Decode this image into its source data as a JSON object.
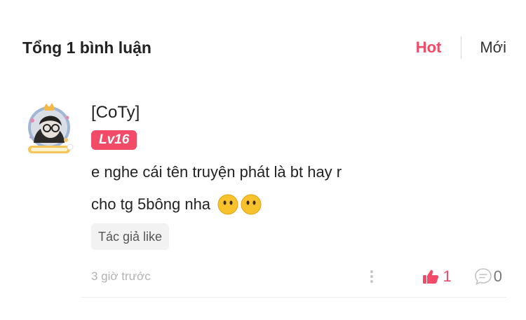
{
  "header": {
    "title": "Tổng 1 bình luận",
    "sort_tabs": [
      {
        "label": "Hot",
        "active": true
      },
      {
        "label": "Mới",
        "active": false
      }
    ]
  },
  "comment": {
    "username": "[CoTy]",
    "level": "Lv16",
    "text_line1": "e nghe cái tên truyện phát là bt hay r",
    "text_line2": "cho tg 5bông nha",
    "emojis": [
      "neutral-face-emoji",
      "neutral-face-emoji"
    ],
    "tag": "Tác giả like",
    "timestamp": "3 giờ trước",
    "likes": "1",
    "replies": "0"
  },
  "colors": {
    "accent": "#f24b68",
    "muted": "#b3b3b3"
  }
}
